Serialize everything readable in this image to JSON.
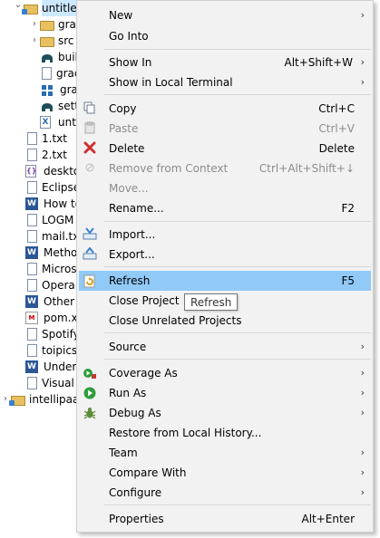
{
  "tree": {
    "items": [
      {
        "label": "untitle",
        "icon": "project-folder-icon",
        "indent": 0,
        "expanded": true
      },
      {
        "label": "grac",
        "icon": "folder-icon",
        "indent": 1,
        "arrow": "collapsed"
      },
      {
        "label": "src",
        "icon": "folder-icon",
        "indent": 1,
        "arrow": "collapsed"
      },
      {
        "label": "buil",
        "icon": "gradle-elephant-icon",
        "indent": 1
      },
      {
        "label": "grac",
        "icon": "file-icon",
        "indent": 1
      },
      {
        "label": "grac",
        "icon": "windows-script-icon",
        "indent": 1
      },
      {
        "label": "sett",
        "icon": "gradle-elephant-icon",
        "indent": 1
      },
      {
        "label": "unt",
        "icon": "xml-x-file-icon",
        "indent": 1
      },
      {
        "label": "1.txt",
        "icon": "text-file-icon",
        "indent": 0
      },
      {
        "label": "2.txt",
        "icon": "text-file-icon",
        "indent": 0
      },
      {
        "label": "deskto",
        "icon": "xml-file-icon",
        "indent": 0
      },
      {
        "label": "Eclipse",
        "icon": "text-file-icon",
        "indent": 0
      },
      {
        "label": "How to",
        "icon": "word-doc-icon",
        "indent": 0
      },
      {
        "label": "LOGM",
        "icon": "text-file-icon",
        "indent": 0
      },
      {
        "label": "mail.tx",
        "icon": "text-file-icon",
        "indent": 0
      },
      {
        "label": "Metho",
        "icon": "word-doc-icon",
        "indent": 0
      },
      {
        "label": "Micros",
        "icon": "text-file-icon",
        "indent": 0
      },
      {
        "label": "Opera",
        "icon": "text-file-icon",
        "indent": 0
      },
      {
        "label": "Other V",
        "icon": "word-doc-icon",
        "indent": 0
      },
      {
        "label": "pom.x",
        "icon": "maven-pom-icon",
        "indent": 0
      },
      {
        "label": "Spotify",
        "icon": "text-file-icon",
        "indent": 0
      },
      {
        "label": "toipics",
        "icon": "text-file-icon",
        "indent": 0
      },
      {
        "label": "Unders",
        "icon": "word-doc-icon",
        "indent": 0
      },
      {
        "label": "Visual",
        "icon": "text-file-icon",
        "indent": 0
      },
      {
        "label": "intellipaat",
        "icon": "project-folder-icon",
        "indent": -1,
        "arrow": "collapsed"
      }
    ]
  },
  "menu": {
    "items": [
      {
        "type": "item",
        "label": "New",
        "accel": "",
        "submenu": true,
        "icon": "",
        "enabled": true
      },
      {
        "type": "item",
        "label": "Go Into",
        "accel": "",
        "submenu": false,
        "icon": "",
        "enabled": true
      },
      {
        "type": "sep"
      },
      {
        "type": "item",
        "label": "Show In",
        "accel": "Alt+Shift+W",
        "submenu": true,
        "icon": "",
        "enabled": true
      },
      {
        "type": "item",
        "label": "Show in Local Terminal",
        "accel": "",
        "submenu": true,
        "icon": "",
        "enabled": true
      },
      {
        "type": "sep"
      },
      {
        "type": "item",
        "label": "Copy",
        "accel": "Ctrl+C",
        "submenu": false,
        "icon": "copy-icon",
        "enabled": true
      },
      {
        "type": "item",
        "label": "Paste",
        "accel": "Ctrl+V",
        "submenu": false,
        "icon": "paste-icon",
        "enabled": false
      },
      {
        "type": "item",
        "label": "Delete",
        "accel": "Delete",
        "submenu": false,
        "icon": "delete-icon",
        "enabled": true
      },
      {
        "type": "item",
        "label": "Remove from Context",
        "accel": "Ctrl+Alt+Shift+↓",
        "submenu": false,
        "icon": "remove-context-icon",
        "enabled": false
      },
      {
        "type": "item",
        "label": "Move...",
        "accel": "",
        "submenu": false,
        "icon": "",
        "enabled": false
      },
      {
        "type": "item",
        "label": "Rename...",
        "accel": "F2",
        "submenu": false,
        "icon": "",
        "enabled": true
      },
      {
        "type": "sep"
      },
      {
        "type": "item",
        "label": "Import...",
        "accel": "",
        "submenu": false,
        "icon": "import-icon",
        "enabled": true
      },
      {
        "type": "item",
        "label": "Export...",
        "accel": "",
        "submenu": false,
        "icon": "export-icon",
        "enabled": true
      },
      {
        "type": "sep"
      },
      {
        "type": "item",
        "label": "Refresh",
        "accel": "F5",
        "submenu": false,
        "icon": "refresh-icon",
        "enabled": true,
        "highlighted": true
      },
      {
        "type": "item",
        "label": "Close Project",
        "accel": "",
        "submenu": false,
        "icon": "",
        "enabled": true
      },
      {
        "type": "item",
        "label": "Close Unrelated Projects",
        "accel": "",
        "submenu": false,
        "icon": "",
        "enabled": true
      },
      {
        "type": "sep"
      },
      {
        "type": "item",
        "label": "Source",
        "accel": "",
        "submenu": true,
        "icon": "",
        "enabled": true
      },
      {
        "type": "sep"
      },
      {
        "type": "item",
        "label": "Coverage As",
        "accel": "",
        "submenu": true,
        "icon": "coverage-icon",
        "enabled": true
      },
      {
        "type": "item",
        "label": "Run As",
        "accel": "",
        "submenu": true,
        "icon": "run-icon",
        "enabled": true
      },
      {
        "type": "item",
        "label": "Debug As",
        "accel": "",
        "submenu": true,
        "icon": "debug-bug-icon",
        "enabled": true
      },
      {
        "type": "item",
        "label": "Restore from Local History...",
        "accel": "",
        "submenu": false,
        "icon": "",
        "enabled": true
      },
      {
        "type": "item",
        "label": "Team",
        "accel": "",
        "submenu": true,
        "icon": "",
        "enabled": true
      },
      {
        "type": "item",
        "label": "Compare With",
        "accel": "",
        "submenu": true,
        "icon": "",
        "enabled": true
      },
      {
        "type": "item",
        "label": "Configure",
        "accel": "",
        "submenu": true,
        "icon": "",
        "enabled": true
      },
      {
        "type": "sep"
      },
      {
        "type": "item",
        "label": "Properties",
        "accel": "Alt+Enter",
        "submenu": false,
        "icon": "",
        "enabled": true
      }
    ]
  },
  "tooltip": {
    "text": "Refresh"
  },
  "colors": {
    "highlight": "#91c9f7",
    "menu_bg": "#f2f2f2",
    "disabled": "#8c8c8c",
    "selection": "#cce8ff"
  }
}
